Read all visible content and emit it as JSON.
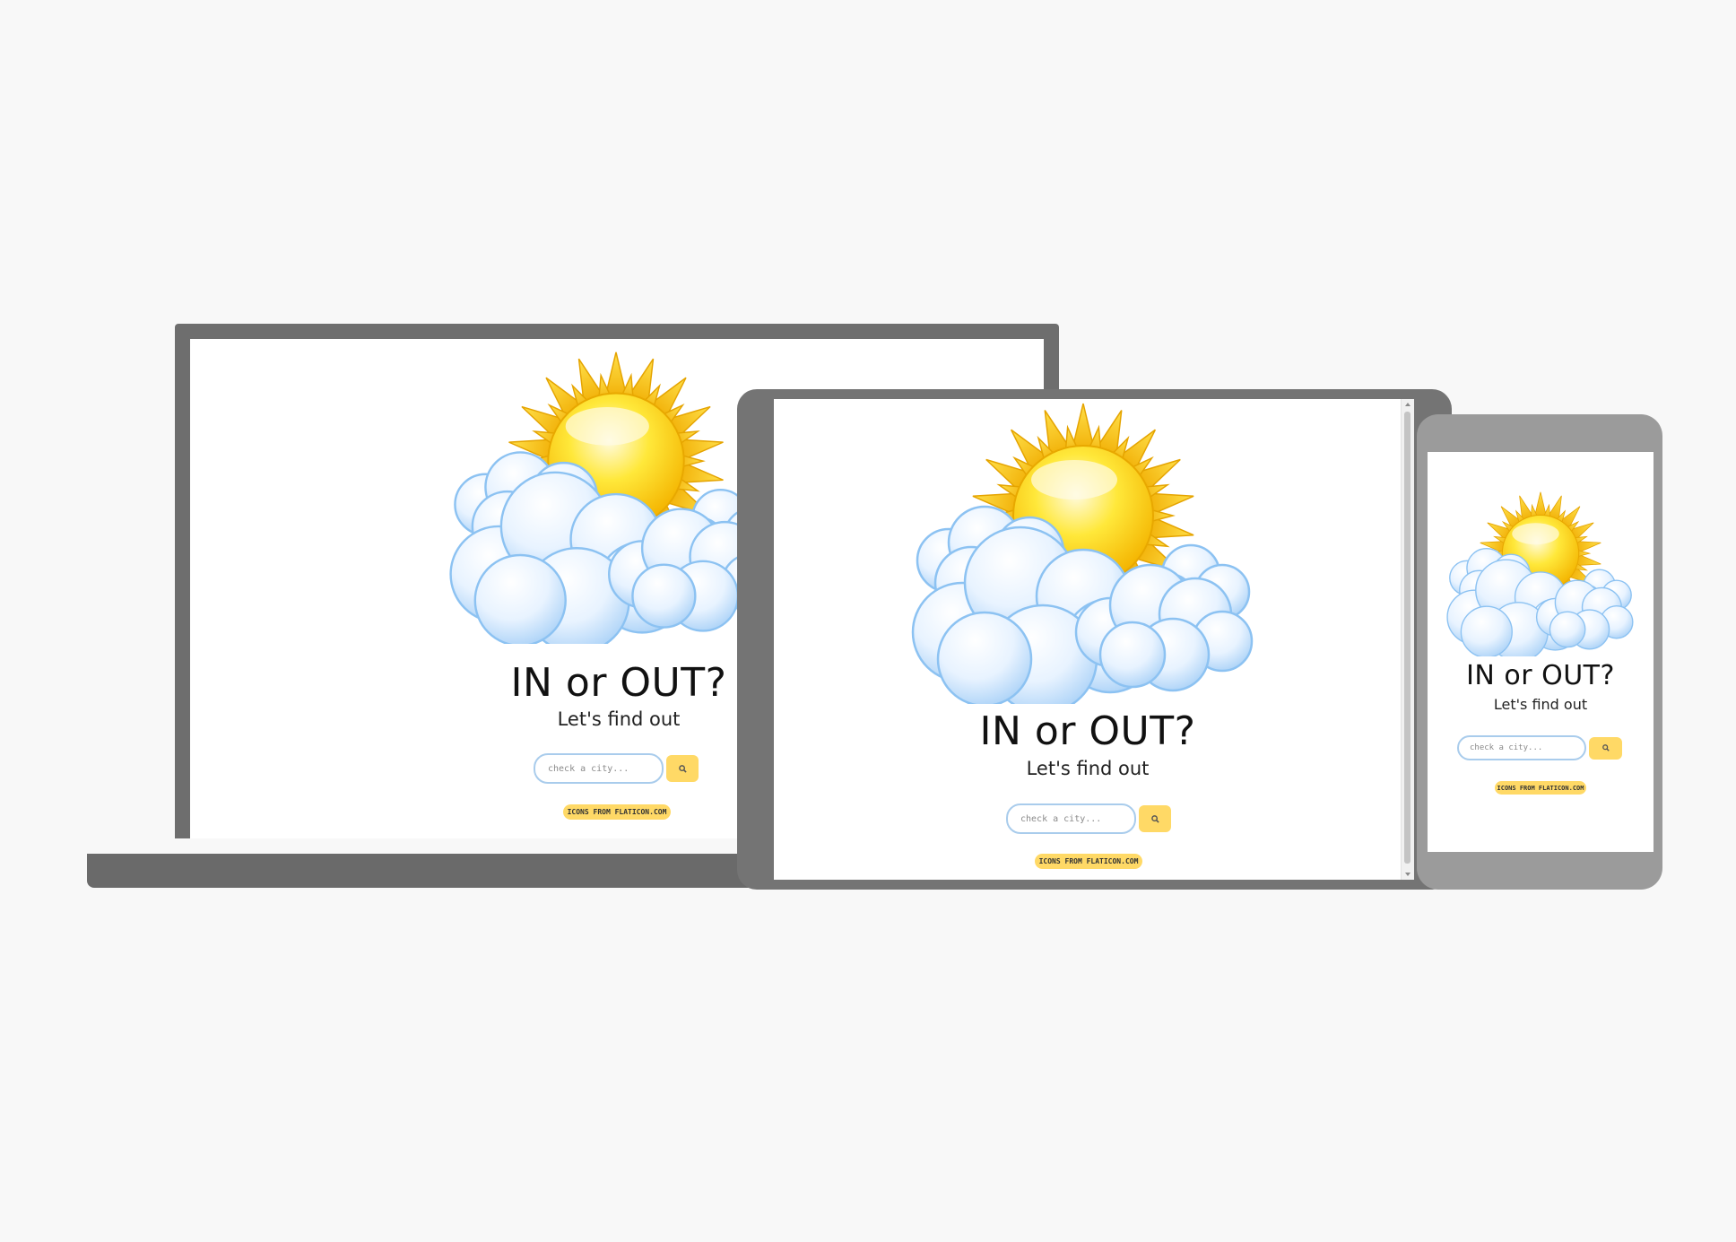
{
  "app": {
    "title": "IN or OUT?",
    "subtitle": "Let's find out",
    "search_placeholder": "check a city...",
    "search_button_icon": "search-icon",
    "credit": "ICONS FROM FLATICON.COM",
    "illustration": "sun-behind-clouds-icon"
  },
  "colors": {
    "background": "#f8f8f8",
    "accent_yellow": "#ffd966",
    "input_border": "#a9ccec",
    "laptop_frame": "#6e6e6e",
    "tablet_frame": "#747474",
    "phone_frame": "#9b9b9b"
  },
  "devices": [
    "laptop",
    "tablet",
    "phone"
  ]
}
